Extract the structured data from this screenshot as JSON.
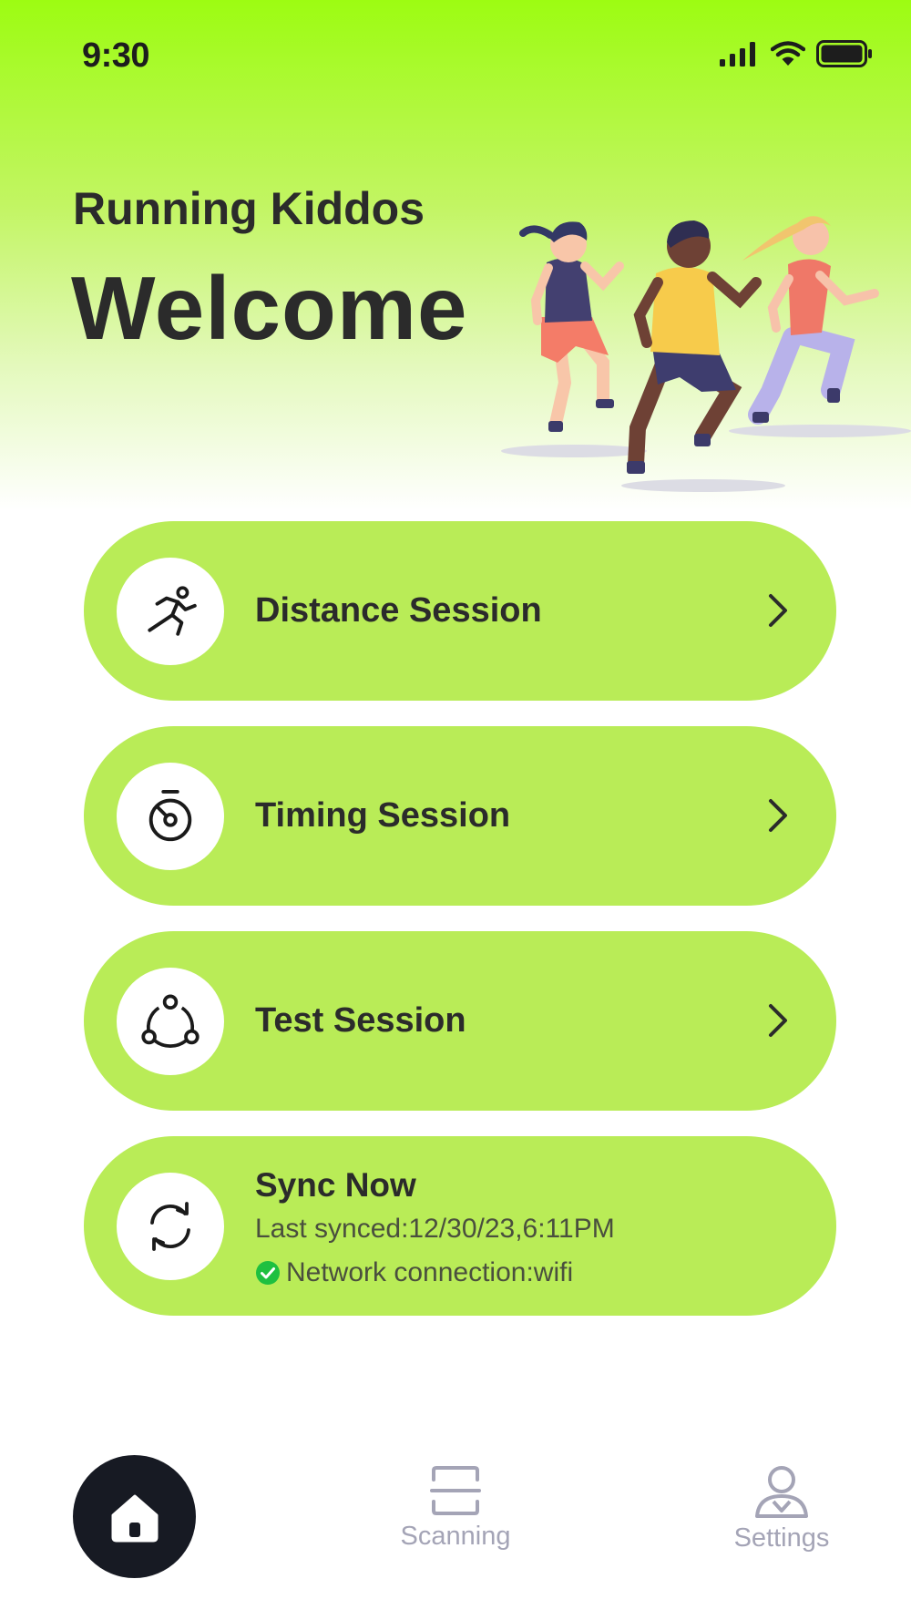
{
  "status_bar": {
    "time": "9:30"
  },
  "header": {
    "app_name": "Running Kiddos",
    "welcome": "Welcome"
  },
  "menu": [
    {
      "label": "Distance Session",
      "icon": "runner-icon"
    },
    {
      "label": "Timing Session",
      "icon": "stopwatch-icon"
    },
    {
      "label": "Test Session",
      "icon": "network-nodes-icon"
    }
  ],
  "sync": {
    "title": "Sync Now",
    "last_synced": "Last synced:12/30/23,6:11PM",
    "network": "Network connection:wifi",
    "status_color": "#1ec040"
  },
  "nav": {
    "home_icon": "home-icon",
    "scanning": "Scanning",
    "settings": "Settings"
  },
  "colors": {
    "accent": "#b9ec57",
    "hero_top": "#9dfc12",
    "nav_active": "#171a23",
    "nav_inactive": "#a4a4b6"
  }
}
